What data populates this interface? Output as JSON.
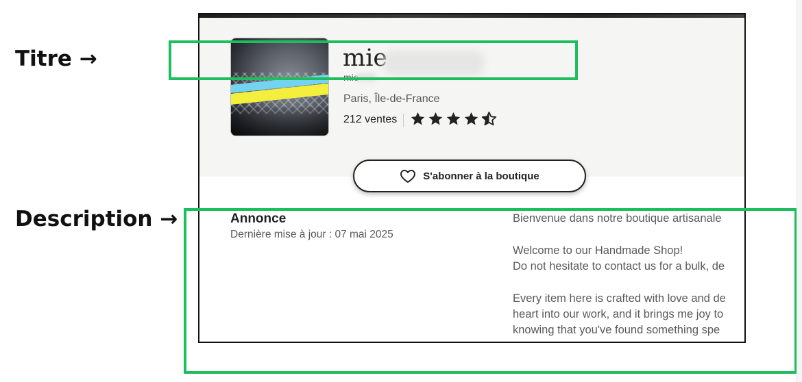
{
  "labels": {
    "title": "Titre →",
    "description": "Description →"
  },
  "shop": {
    "name_visible": "mie",
    "handle_visible": "mie",
    "location": "Paris, Île-de-France",
    "sales": "212 ventes",
    "rating_stars": 4.5,
    "follow_button": "S'abonner à la boutique"
  },
  "announcement": {
    "heading": "Annonce",
    "updated": "Dernière mise à jour : 07 mai 2025",
    "lines": [
      "Bienvenue dans notre boutique artisanale",
      "Welcome to our Handmade Shop!",
      "Do not hesitate to contact us for a bulk, de",
      "Every item here is crafted with love and de",
      "heart into our work, and it brings me joy to",
      "knowing that you've found something spe"
    ]
  },
  "colors": {
    "highlight": "#1dbe5e",
    "header_bg": "#f5f5f4",
    "avatar_blue": "#73d4ef",
    "avatar_yellow": "#f4ef3c"
  },
  "icons": [
    "heart-icon",
    "star-icon",
    "half-star-icon"
  ]
}
